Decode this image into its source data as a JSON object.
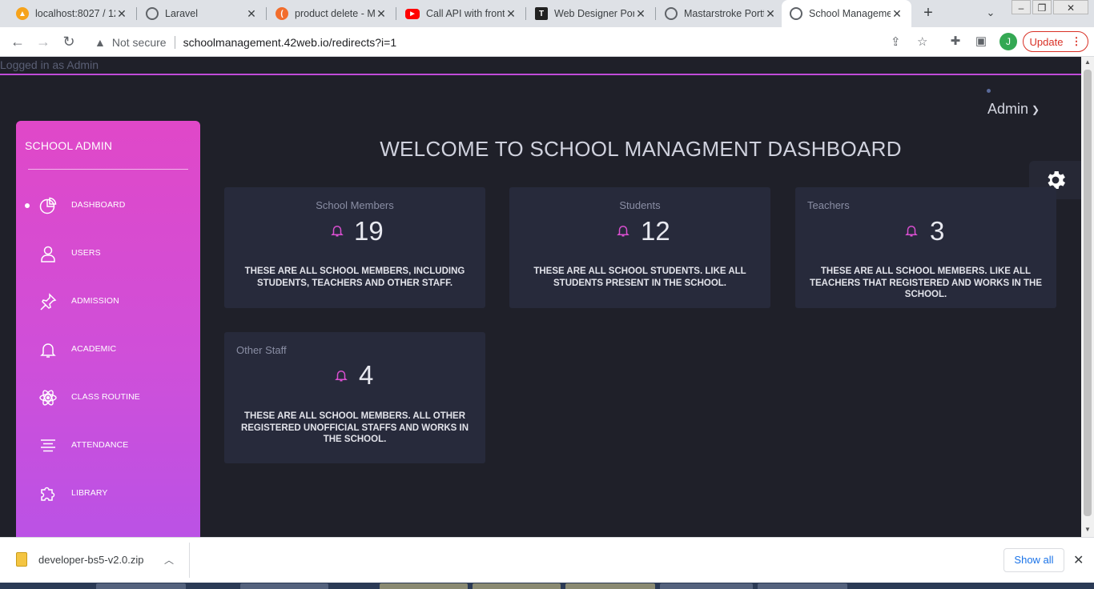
{
  "browser": {
    "tabs": [
      {
        "title": "localhost:8027 / 12",
        "color": "#f6a31b",
        "glyph": "▲"
      },
      {
        "title": "Laravel",
        "color": "#5f6368",
        "glyph": "◎"
      },
      {
        "title": "product delete - M",
        "color": "#f26d2c",
        "glyph": "("
      },
      {
        "title": "Call API with front",
        "color": "#ff0000",
        "glyph": "▶"
      },
      {
        "title": "Web Designer Por",
        "color": "#222222",
        "glyph": "T"
      },
      {
        "title": "Mastarstroke Portf",
        "color": "#5f6368",
        "glyph": "◎"
      },
      {
        "title": "School Manageme",
        "color": "#5f6368",
        "glyph": "◎"
      }
    ],
    "security_label": "Not secure",
    "url": "schoolmanagement.42web.io/redirects?i=1",
    "profile_initial": "J",
    "update_label": "Update"
  },
  "page": {
    "logged_in_text": "Logged in as Admin",
    "admin_label": "Admin",
    "sidebar": {
      "title": "SCHOOL ADMIN",
      "items": [
        {
          "label": "DASHBOARD",
          "icon": "pie-chart-icon",
          "active": true
        },
        {
          "label": "USERS",
          "icon": "user-icon",
          "active": false
        },
        {
          "label": "ADMISSION",
          "icon": "pin-icon",
          "active": false
        },
        {
          "label": "ACADEMIC",
          "icon": "bell-icon",
          "active": false
        },
        {
          "label": "CLASS ROUTINE",
          "icon": "atom-icon",
          "active": false
        },
        {
          "label": "ATTENDANCE",
          "icon": "align-center-icon",
          "active": false
        },
        {
          "label": "LIBRARY",
          "icon": "puzzle-icon",
          "active": false
        }
      ]
    },
    "welcome_title": "WELCOME TO SCHOOL MANAGMENT DASHBOARD",
    "cards": [
      {
        "title": "School Members",
        "count": "19",
        "description": "THESE ARE ALL SCHOOL MEMBERS, INCLUDING STUDENTS, TEACHERS AND OTHER STAFF."
      },
      {
        "title": "Students",
        "count": "12",
        "description": "THESE ARE ALL SCHOOL STUDENTS. LIKE ALL STUDENTS PRESENT IN THE SCHOOL."
      },
      {
        "title": "Teachers",
        "count": "3",
        "description": "THESE ARE ALL SCHOOL MEMBERS. LIKE ALL TEACHERS THAT REGISTERED AND WORKS IN THE SCHOOL."
      },
      {
        "title": "Other Staff",
        "count": "4",
        "description": "THESE ARE ALL SCHOOL MEMBERS. ALL OTHER REGISTERED UNOFFICIAL STAFFS AND WORKS IN THE SCHOOL."
      }
    ],
    "accent_color": "#d94fd0",
    "background_color": "#1f2029",
    "card_color": "#272a3b"
  },
  "downloads": {
    "file_name": "developer-bs5-v2.0.zip",
    "show_all_label": "Show all"
  }
}
